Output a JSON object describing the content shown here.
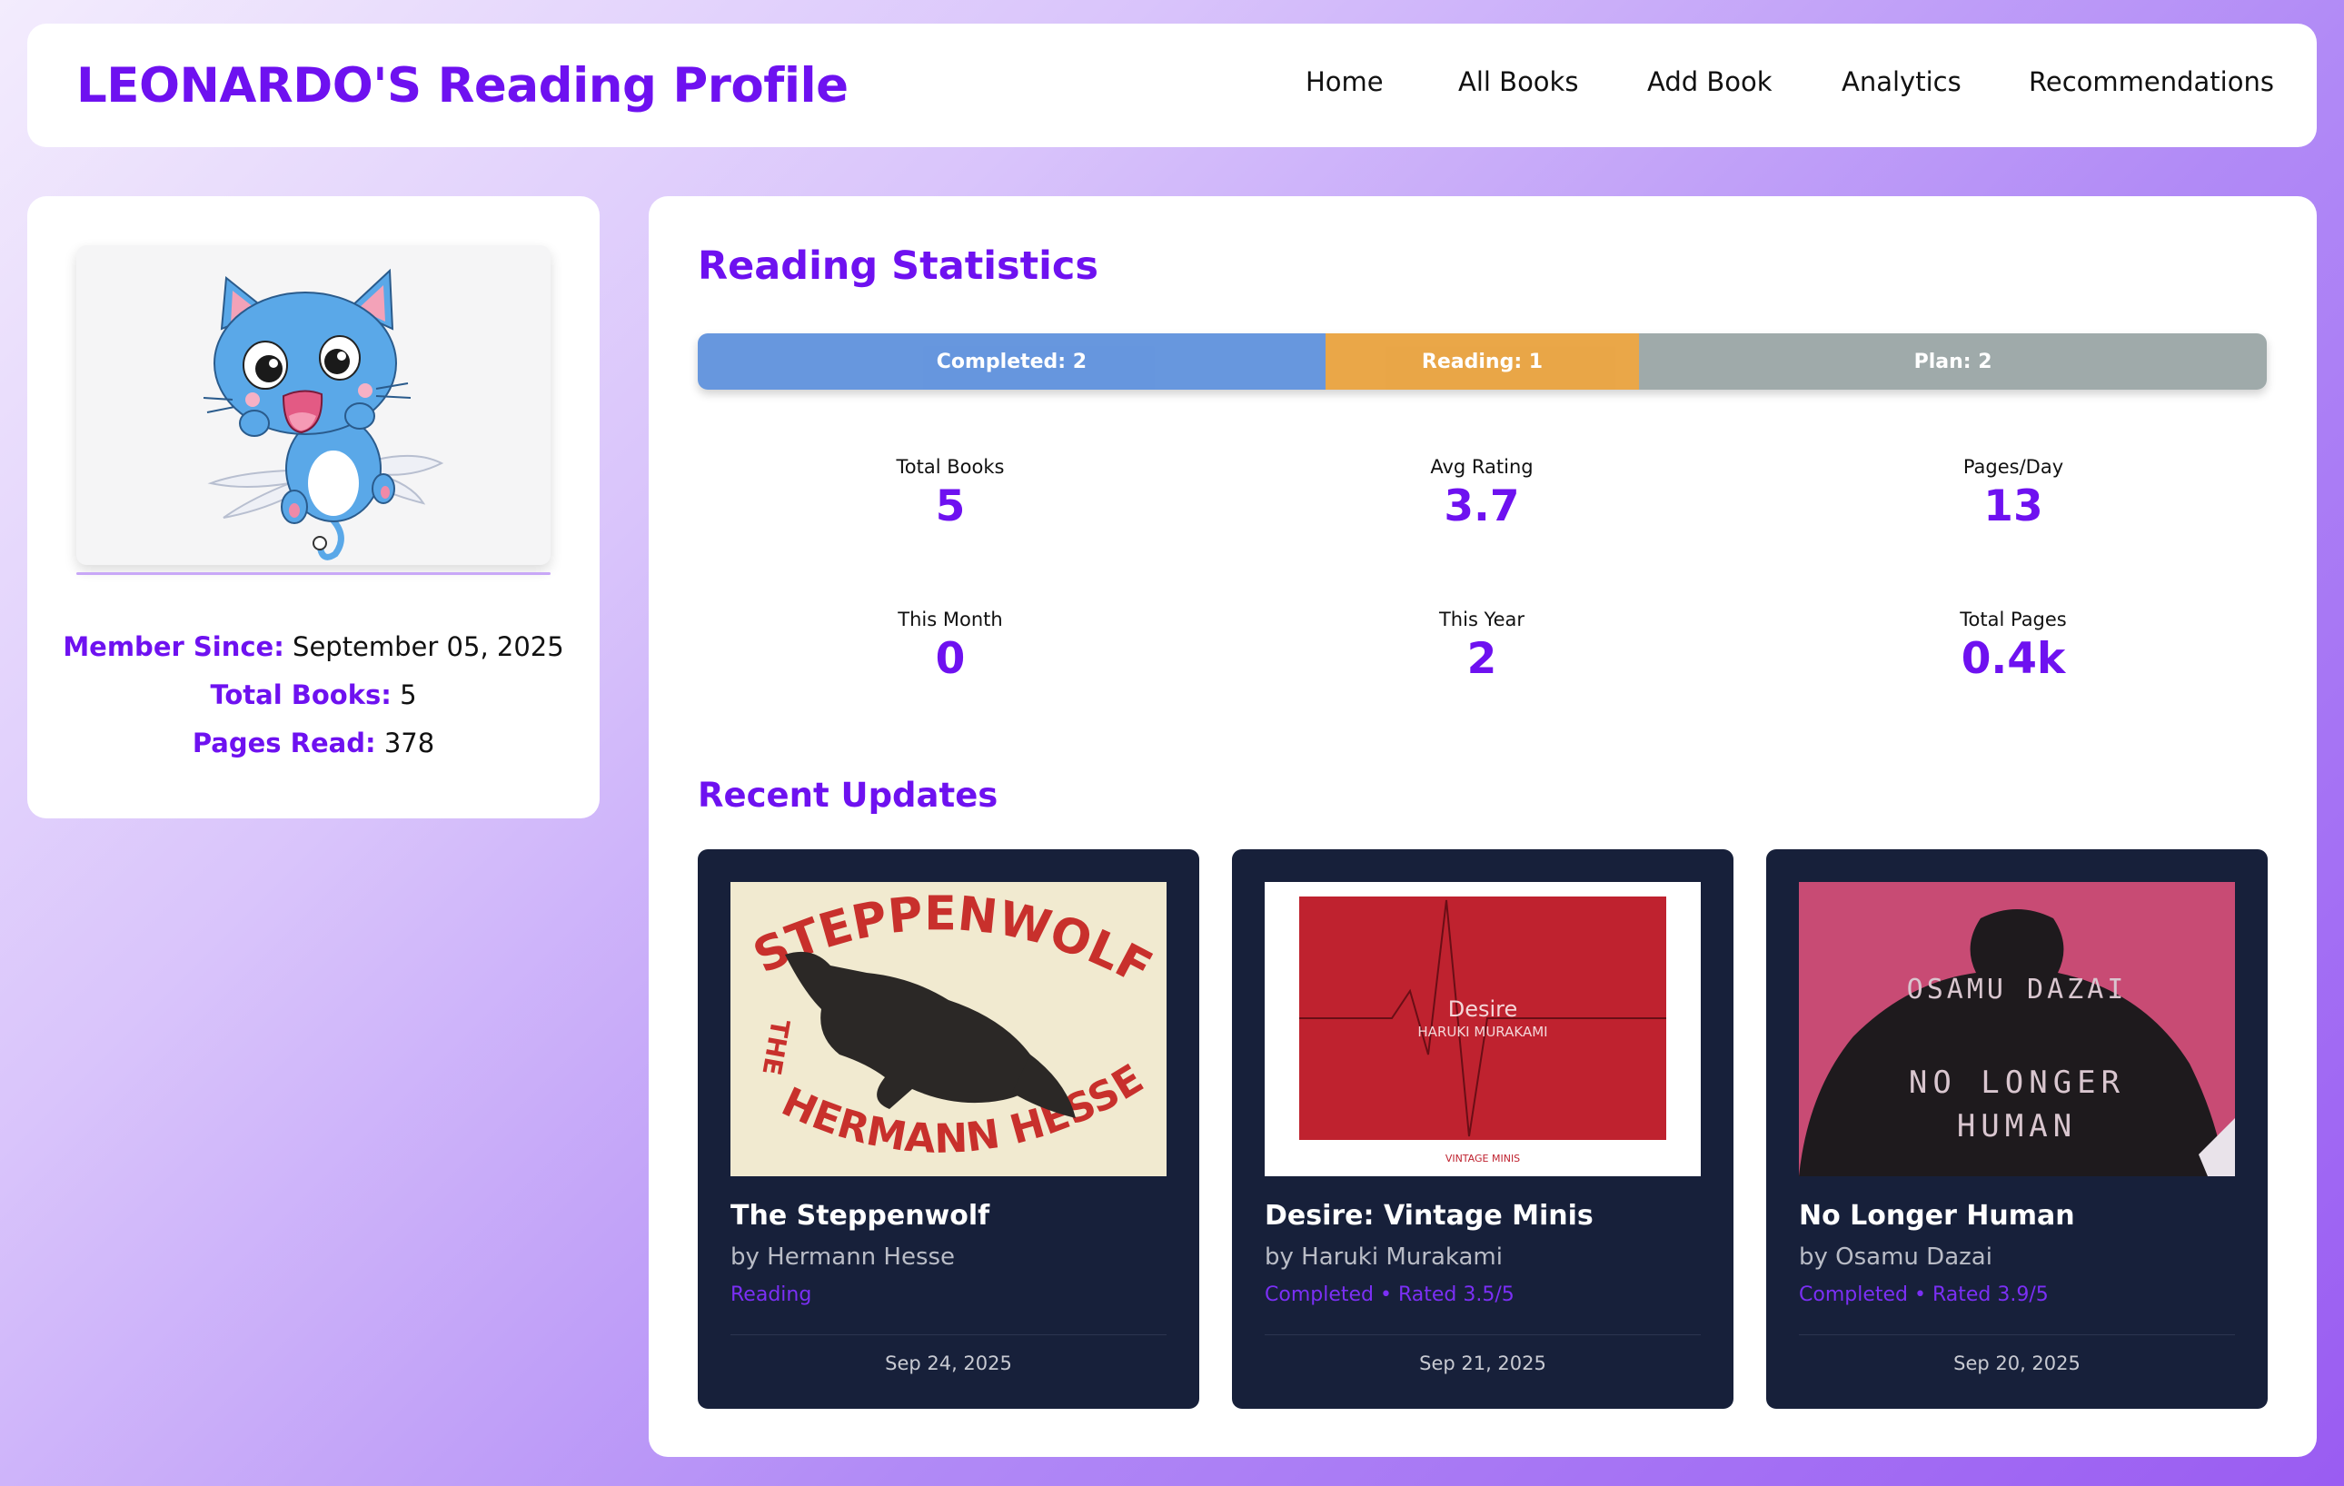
{
  "header": {
    "title": "LEONARDO'S Reading Profile",
    "nav": [
      "Home",
      "All Books",
      "Add Book",
      "Analytics",
      "Recommendations"
    ]
  },
  "profile": {
    "member_since_label": "Member Since:",
    "member_since_value": "September 05, 2025",
    "total_books_label": "Total Books:",
    "total_books_value": "5",
    "pages_read_label": "Pages Read:",
    "pages_read_value": "378"
  },
  "stats": {
    "title": "Reading Statistics",
    "progress": [
      {
        "label": "Completed: 2",
        "count": 2,
        "color": "#5b8fdc"
      },
      {
        "label": "Reading: 1",
        "count": 1,
        "color": "#e8a03a"
      },
      {
        "label": "Plan: 2",
        "count": 2,
        "color": "#98a4a4"
      }
    ],
    "items": [
      {
        "label": "Total Books",
        "value": "5"
      },
      {
        "label": "Avg Rating",
        "value": "3.7"
      },
      {
        "label": "Pages/Day",
        "value": "13"
      },
      {
        "label": "This Month",
        "value": "0"
      },
      {
        "label": "This Year",
        "value": "2"
      },
      {
        "label": "Total Pages",
        "value": "0.4k"
      }
    ]
  },
  "recent": {
    "title": "Recent Updates",
    "books": [
      {
        "title": "The Steppenwolf",
        "author": "by Hermann Hesse",
        "status": "Reading",
        "date": "Sep 24, 2025"
      },
      {
        "title": "Desire: Vintage Minis",
        "author": "by Haruki Murakami",
        "status": "Completed • Rated 3.5/5",
        "date": "Sep 21, 2025"
      },
      {
        "title": "No Longer Human",
        "author": "by Osamu Dazai",
        "status": "Completed • Rated 3.9/5",
        "date": "Sep 20, 2025"
      }
    ]
  },
  "covers": {
    "steppenwolf": {
      "top_text": "STEPPENWOLF",
      "side_text": "THE",
      "bottom_text": "HERMANN HESSE"
    },
    "desire": {
      "title": "Desire",
      "author": "HARUKI MURAKAMI",
      "publisher": "VINTAGE MINIS"
    },
    "no_longer_human": {
      "author": "OSAMU DAZAI",
      "title_line1": "NO LONGER",
      "title_line2": "HUMAN"
    }
  }
}
